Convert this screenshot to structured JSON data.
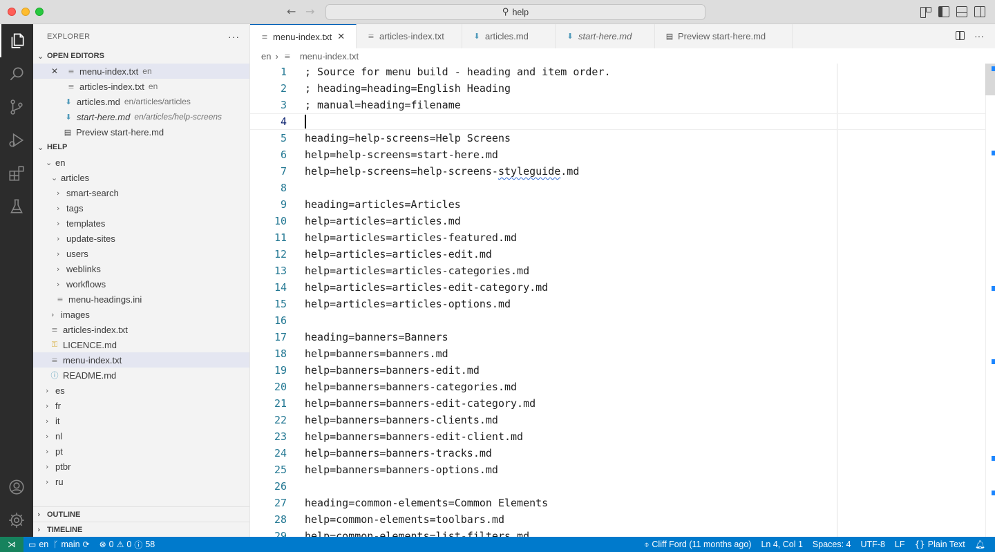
{
  "title_bar": {
    "search_text": "help"
  },
  "sidebar": {
    "title": "EXPLORER",
    "open_editors": {
      "label": "OPEN EDITORS",
      "items": [
        {
          "name": "menu-index.txt",
          "desc": "en",
          "icon": "text-file-icon"
        },
        {
          "name": "articles-index.txt",
          "desc": "en",
          "icon": "text-file-icon"
        },
        {
          "name": "articles.md",
          "desc": "en/articles/articles",
          "icon": "markdown-icon"
        },
        {
          "name": "start-here.md",
          "desc": "en/articles/help-screens",
          "icon": "markdown-icon"
        },
        {
          "name": "Preview start-here.md",
          "desc": "",
          "icon": "preview-icon"
        }
      ]
    },
    "help": {
      "label": "HELP",
      "tree": [
        {
          "label": "en",
          "kind": "folder-open"
        },
        {
          "label": "articles",
          "kind": "folder-open"
        },
        {
          "label": "smart-search",
          "kind": "folder"
        },
        {
          "label": "tags",
          "kind": "folder"
        },
        {
          "label": "templates",
          "kind": "folder"
        },
        {
          "label": "update-sites",
          "kind": "folder"
        },
        {
          "label": "users",
          "kind": "folder"
        },
        {
          "label": "weblinks",
          "kind": "folder"
        },
        {
          "label": "workflows",
          "kind": "folder"
        },
        {
          "label": "menu-headings.ini",
          "kind": "file"
        },
        {
          "label": "images",
          "kind": "folder"
        },
        {
          "label": "articles-index.txt",
          "kind": "file"
        },
        {
          "label": "LICENCE.md",
          "kind": "file"
        },
        {
          "label": "menu-index.txt",
          "kind": "file"
        },
        {
          "label": "README.md",
          "kind": "file"
        },
        {
          "label": "es",
          "kind": "folder"
        },
        {
          "label": "fr",
          "kind": "folder"
        },
        {
          "label": "it",
          "kind": "folder"
        },
        {
          "label": "nl",
          "kind": "folder"
        },
        {
          "label": "pt",
          "kind": "folder"
        },
        {
          "label": "ptbr",
          "kind": "folder"
        },
        {
          "label": "ru",
          "kind": "folder"
        }
      ]
    },
    "outline_label": "OUTLINE",
    "timeline_label": "TIMELINE"
  },
  "tabs": [
    {
      "label": "menu-index.txt",
      "active": true
    },
    {
      "label": "articles-index.txt",
      "active": false
    },
    {
      "label": "articles.md",
      "active": false
    },
    {
      "label": "start-here.md",
      "active": false
    },
    {
      "label": "Preview start-here.md",
      "active": false
    }
  ],
  "breadcrumb": {
    "folder": "en",
    "file": "menu-index.txt"
  },
  "editor": {
    "lines": [
      "; Source for menu build - heading and item order.",
      "; heading=heading=English Heading",
      "; manual=heading=filename",
      "",
      "heading=help-screens=Help Screens",
      "help=help-screens=start-here.md",
      "help=help-screens=help-screens-styleguide.md",
      "",
      "heading=articles=Articles",
      "help=articles=articles.md",
      "help=articles=articles-featured.md",
      "help=articles=articles-edit.md",
      "help=articles=articles-categories.md",
      "help=articles=articles-edit-category.md",
      "help=articles=articles-options.md",
      "",
      "heading=banners=Banners",
      "help=banners=banners.md",
      "help=banners=banners-edit.md",
      "help=banners=banners-categories.md",
      "help=banners=banners-edit-category.md",
      "help=banners=banners-clients.md",
      "help=banners=banners-edit-client.md",
      "help=banners=banners-tracks.md",
      "help=banners=banners-options.md",
      "",
      "heading=common-elements=Common Elements",
      "help=common-elements=toolbars.md",
      "help=common-elements=list-filters.md"
    ],
    "current_line": 4
  },
  "status_bar": {
    "branch_folder": "en",
    "branch": "main",
    "errors": "0",
    "warnings": "0",
    "infos": "58",
    "blame": "Cliff Ford (11 months ago)",
    "position": "Ln 4, Col 1",
    "spaces": "Spaces: 4",
    "encoding": "UTF-8",
    "eol": "LF",
    "language": "Plain Text"
  },
  "colors": {
    "accent": "#007acc",
    "remote": "#16825d",
    "activity_bar": "#2c2c2c"
  }
}
